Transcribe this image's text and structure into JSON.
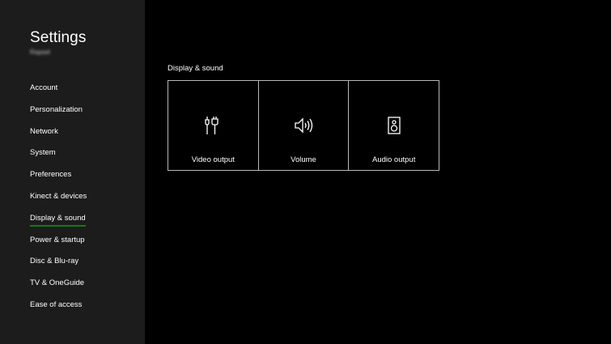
{
  "sidebar": {
    "title": "Settings",
    "gamertag": "Rapsel",
    "items": [
      {
        "label": "Account"
      },
      {
        "label": "Personalization"
      },
      {
        "label": "Network"
      },
      {
        "label": "System"
      },
      {
        "label": "Preferences"
      },
      {
        "label": "Kinect & devices"
      },
      {
        "label": "Display & sound",
        "selected": true
      },
      {
        "label": "Power & startup"
      },
      {
        "label": "Disc & Blu-ray"
      },
      {
        "label": "TV & OneGuide"
      },
      {
        "label": "Ease of access"
      }
    ]
  },
  "main": {
    "section_title": "Display & sound",
    "tiles": [
      {
        "label": "Video output",
        "icon": "hdmi-cable-icon"
      },
      {
        "label": "Volume",
        "icon": "speaker-volume-icon"
      },
      {
        "label": "Audio output",
        "icon": "speaker-box-icon"
      }
    ]
  },
  "colors": {
    "background": "#000000",
    "sidebar": "#1c1c1c",
    "accent": "#107c10",
    "tile_border": "#b8b8b8"
  }
}
